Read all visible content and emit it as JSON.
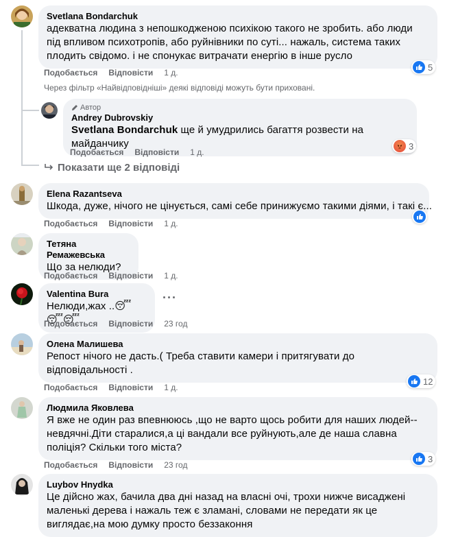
{
  "actions": {
    "like": "Подобається",
    "reply": "Відповісти"
  },
  "comments": [
    {
      "name": "Svetlana Bondarchuk",
      "text": "адекватна людина з непошкодженою психікою такого не зробить. або люди під впливом психотропів, або руйнівники по суті... нажаль, система таких плодить свідомо. і не спонукає витрачати енергію в інше русло",
      "time": "1 д.",
      "reaction_count": "5"
    }
  ],
  "filter_note": "Через фільтр «Найвідповідніші» деякі відповіді можуть бути приховані.",
  "reply": {
    "author_tag": "Автор",
    "name": "Andrey Dubrovskiy",
    "mention": "Svetlana Bondarchuk",
    "text": " ще й умудрились багаття розвести на майданчику",
    "time": "1 д.",
    "reaction_count": "3"
  },
  "show_more": "Показати ще 2 відповіді",
  "others": [
    {
      "name": "Elena Razantseva",
      "text": "Шкода, дуже, нічого не цінується, самі себе принижуємо такими діями, і такі є...",
      "time": "1 д."
    },
    {
      "name": "Тетяна Ремажевська",
      "text": "Що за нелюди?",
      "time": "1 д."
    },
    {
      "name": "Valentina Bura",
      "text": "Нелюди,жах ..😴😴😴",
      "time": "23 год"
    },
    {
      "name": "Олена Малишева",
      "text": "Репост нічого не дасть.( Треба ставити камери і притягувати до відповідальності .",
      "time": "1 д.",
      "reaction_count": "12"
    },
    {
      "name": "Людмила Яковлева",
      "text": "Я вже не один раз впевнююсь ,що не варто щось робити для наших людей--невдячні.Діти старалися,а ці вандали все руйнують,але де наша славна поліція? Скільки того міста?",
      "time": "23 год",
      "reaction_count": "3"
    },
    {
      "name": "Luybov Hnydka",
      "text": "Це дійсно жах, бачила два дні назад на власні очі, трохи нижче висаджені маленькі дерева і нажаль теж є зламані, словами не передати як це виглядає,на мою думку просто беззаконня"
    }
  ],
  "colors": {
    "like_blue": "#1877f2",
    "bubble": "#f0f2f5",
    "meta_gray": "#65676b"
  }
}
